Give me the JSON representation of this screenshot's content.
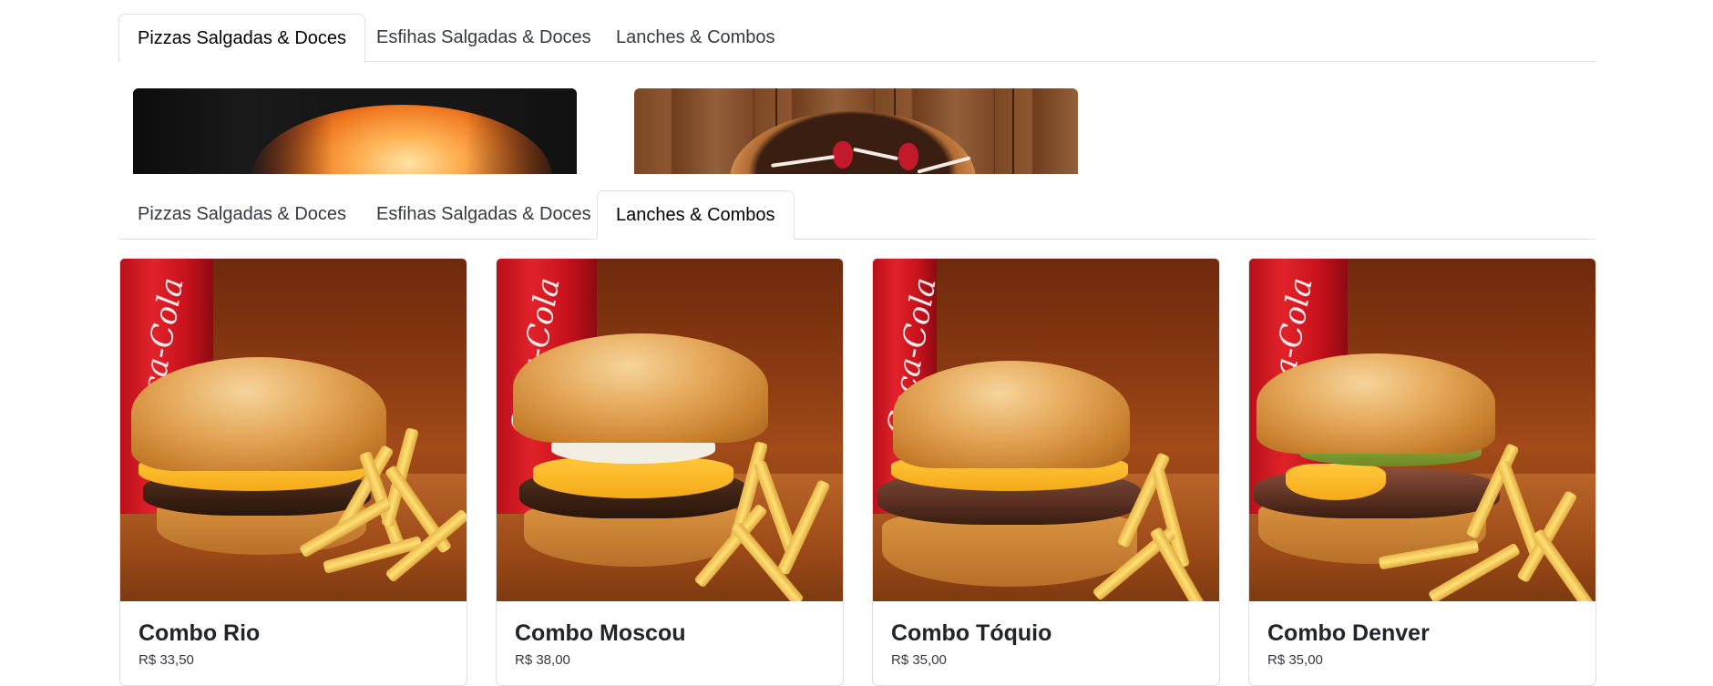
{
  "tabs_top": [
    {
      "label": "Pizzas Salgadas & Doces",
      "active": true
    },
    {
      "label": "Esfihas Salgadas & Doces",
      "active": false
    },
    {
      "label": "Lanches & Combos",
      "active": false
    }
  ],
  "tabs_bottom": [
    {
      "label": "Pizzas Salgadas & Doces",
      "active": false
    },
    {
      "label": "Esfihas Salgadas & Doces",
      "active": false
    },
    {
      "label": "Lanches & Combos",
      "active": true
    }
  ],
  "combos": [
    {
      "title": "Combo Rio",
      "price": "R$ 33,50"
    },
    {
      "title": "Combo Moscou",
      "price": "R$ 38,00"
    },
    {
      "title": "Combo Tóquio",
      "price": "R$ 35,00"
    },
    {
      "title": "Combo Denver",
      "price": "R$ 35,00"
    }
  ],
  "can_text": "Coca-Cola"
}
